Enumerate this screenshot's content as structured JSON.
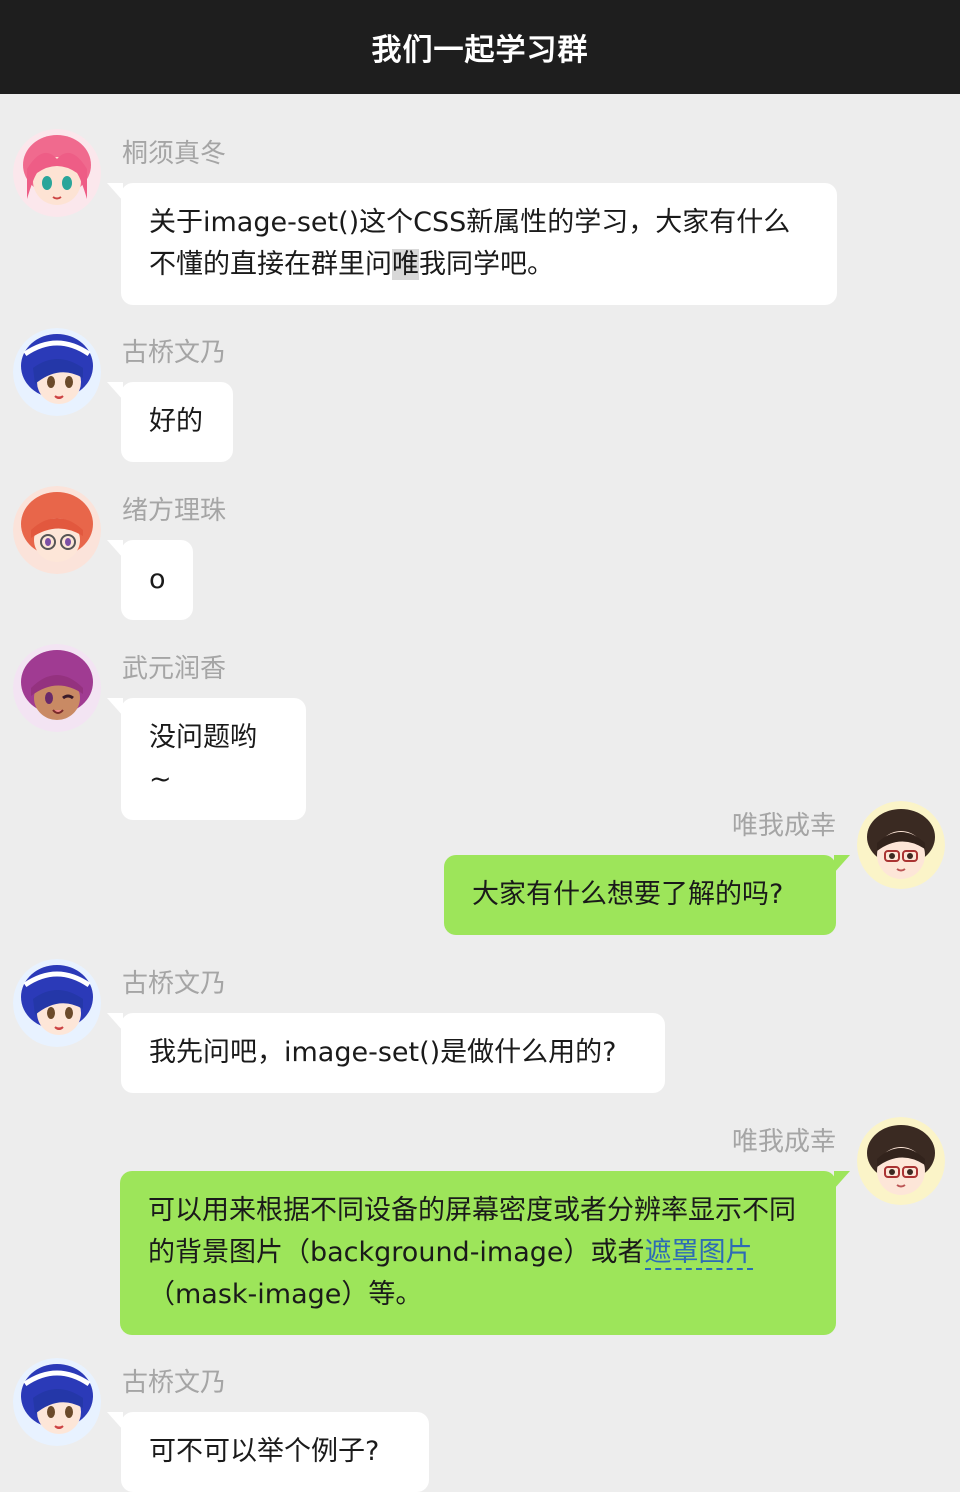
{
  "header": {
    "title": "我们一起学习群"
  },
  "messages": [
    {
      "side": "left",
      "sender": "桐须真冬",
      "avatar": "pink-hair-girl-avatar",
      "text_before": "关于image-set()这个CSS新属性的学习，大家有什么不懂的直接在群里问",
      "text_highlight": "唯",
      "text_after": "我同学吧。"
    },
    {
      "side": "left",
      "sender": "古桥文乃",
      "avatar": "blue-hair-girl-avatar",
      "text": "好的"
    },
    {
      "side": "left",
      "sender": "绪方理珠",
      "avatar": "orange-hair-glasses-girl-avatar",
      "text": "o"
    },
    {
      "side": "left",
      "sender": "武元润香",
      "avatar": "purple-hair-girl-avatar",
      "text": "没问题哟~"
    },
    {
      "side": "right",
      "sender": "唯我成幸",
      "avatar": "brown-hair-boy-avatar",
      "text": "大家有什么想要了解的吗?"
    },
    {
      "side": "left",
      "sender": "古桥文乃",
      "avatar": "blue-hair-girl-avatar",
      "text": "我先问吧，image-set()是做什么用的?"
    },
    {
      "side": "right",
      "sender": "唯我成幸",
      "avatar": "brown-hair-boy-avatar",
      "text_before": "可以用来根据不同设备的屏幕密度或者分辨率显示不同的背景图片（background-image）或者",
      "link_text": "遮罩图片",
      "text_after": "（mask-image）等。"
    },
    {
      "side": "left",
      "sender": "古桥文乃",
      "avatar": "blue-hair-girl-avatar",
      "text": "可不可以举个例子?"
    }
  ],
  "colors": {
    "header_bg": "#1e1e1e",
    "chat_bg": "#ededed",
    "left_bubble": "#ffffff",
    "right_bubble": "#9de55a",
    "name_text": "#a5a5a5",
    "link": "#2d6bb5"
  }
}
